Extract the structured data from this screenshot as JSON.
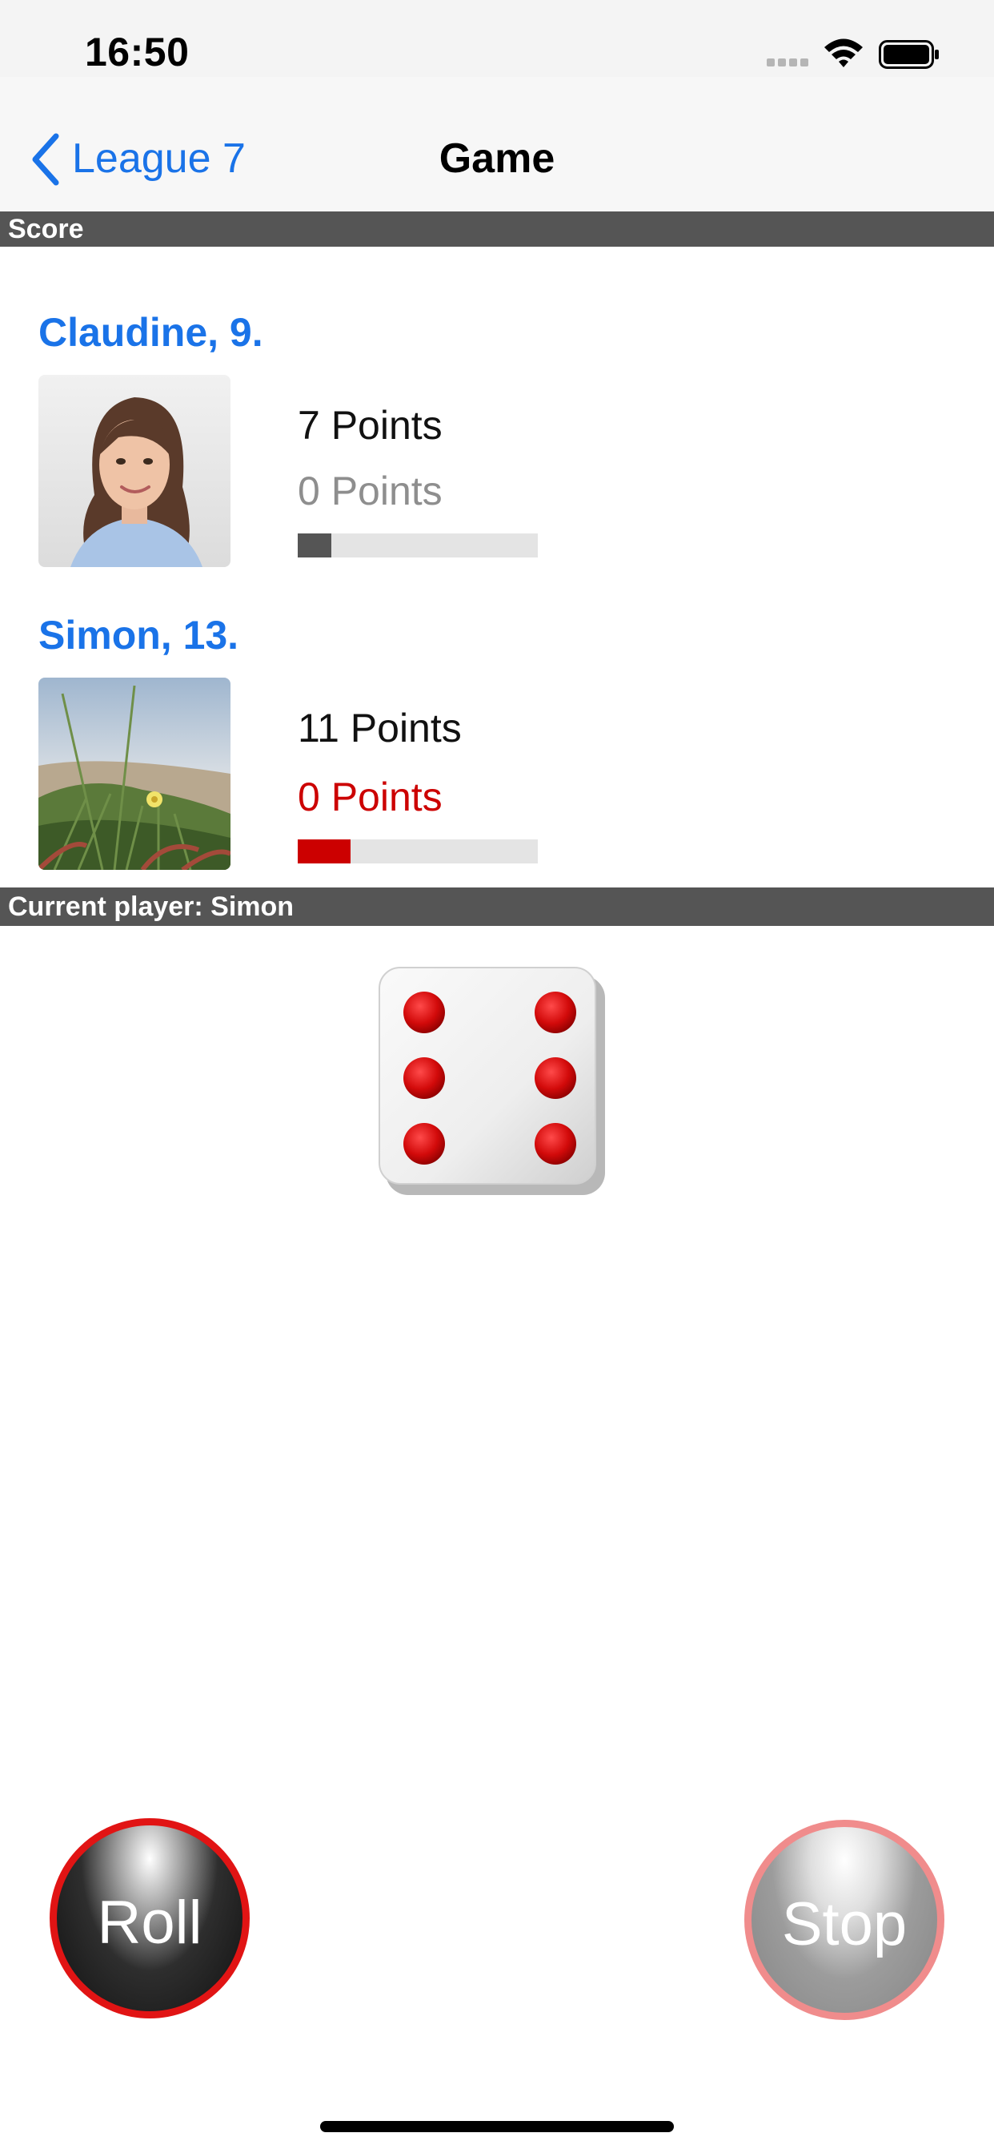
{
  "status_bar": {
    "time": "16:50"
  },
  "nav": {
    "back_label": "League 7",
    "title": "Game"
  },
  "sections": {
    "score": "Score",
    "current_player": "Current player: Simon"
  },
  "players": [
    {
      "name": "Claudine, 9.",
      "total_points": "7 Points",
      "round_points": "0 Points",
      "progress": 0.14,
      "progress_color": "#555555",
      "round_color": "#8e8e8e"
    },
    {
      "name": "Simon, 13.",
      "total_points": "11 Points",
      "round_points": "0 Points",
      "progress": 0.22,
      "progress_color": "#cc0000",
      "round_color": "#cc0000"
    }
  ],
  "dice": {
    "value": 6
  },
  "buttons": {
    "roll": "Roll",
    "stop": "Stop"
  },
  "colors": {
    "accent": "#1a73e8",
    "header": "#555555",
    "red": "#cc0000"
  }
}
